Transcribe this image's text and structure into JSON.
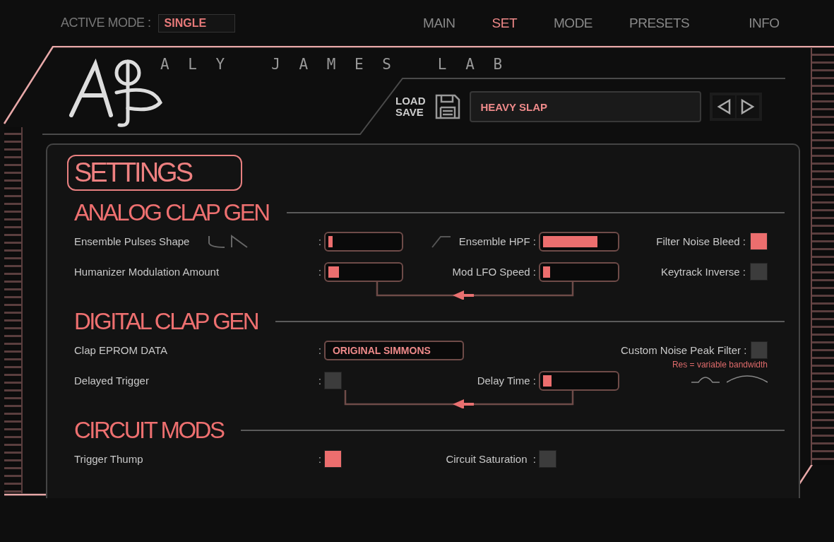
{
  "top_bar": {
    "mode_label": "ACTIVE MODE :",
    "mode_value": "SINGLE"
  },
  "tabs": [
    {
      "label": "MAIN",
      "selected": false
    },
    {
      "label": "SET",
      "selected": true
    },
    {
      "label": "MODE",
      "selected": false
    },
    {
      "label": "PRESETS",
      "selected": false
    },
    {
      "label": "INFO",
      "selected": false
    }
  ],
  "brand": "A L Y   J A M E S   L A B",
  "preset": {
    "load": "LOAD",
    "save": "SAVE",
    "name": "HEAVY SLAP"
  },
  "settings_title": "SETTINGS",
  "sections": [
    {
      "title": "ANALOG CLAP GEN",
      "mod_link": true,
      "rows": [
        {
          "label": "Ensemble Pulses Shape",
          "left": {
            "kind": "slider",
            "prefix": ":",
            "level": 0.06
          },
          "mid_label": "Ensemble HPF :",
          "mid": {
            "kind": "slider",
            "level": 0.75
          },
          "right_label": "Filter Noise Bleed :",
          "right": {
            "kind": "checkbox",
            "checked": true
          }
        },
        {
          "label": "Humanizer Modulation Amount",
          "left": {
            "kind": "slider",
            "prefix": ":",
            "level": 0.15
          },
          "mid_label": "Mod LFO Speed :",
          "mid": {
            "kind": "slider",
            "level": 0.1
          },
          "right_label": "Keytrack Inverse :",
          "right": {
            "kind": "checkbox",
            "checked": false
          }
        }
      ]
    },
    {
      "title": "DIGITAL CLAP GEN",
      "mod_link": true,
      "rows": [
        {
          "label": "Clap EPROM DATA",
          "left": {
            "kind": "dropdown",
            "prefix": ":",
            "value": "ORIGINAL SIMMONS"
          },
          "right_label": "Custom Noise Peak Filter :",
          "right": {
            "kind": "checkbox",
            "checked": false
          }
        },
        {
          "label": "Delayed Trigger",
          "left": {
            "kind": "checkbox",
            "prefix": ":",
            "checked": false
          },
          "mid_label": "Delay Time :",
          "mid": {
            "kind": "slider",
            "level": 0.12
          },
          "right": {
            "kind": "note",
            "text": "Res = variable bandwidth"
          }
        }
      ]
    },
    {
      "title": "CIRCUIT MODS",
      "mod_link": false,
      "rows": [
        {
          "label": "Trigger Thump",
          "left": {
            "kind": "checkbox",
            "prefix": ":",
            "checked": true
          },
          "mid_label": "Circuit Saturation  :",
          "mid": {
            "kind": "checkbox",
            "checked": false
          }
        }
      ]
    }
  ]
}
